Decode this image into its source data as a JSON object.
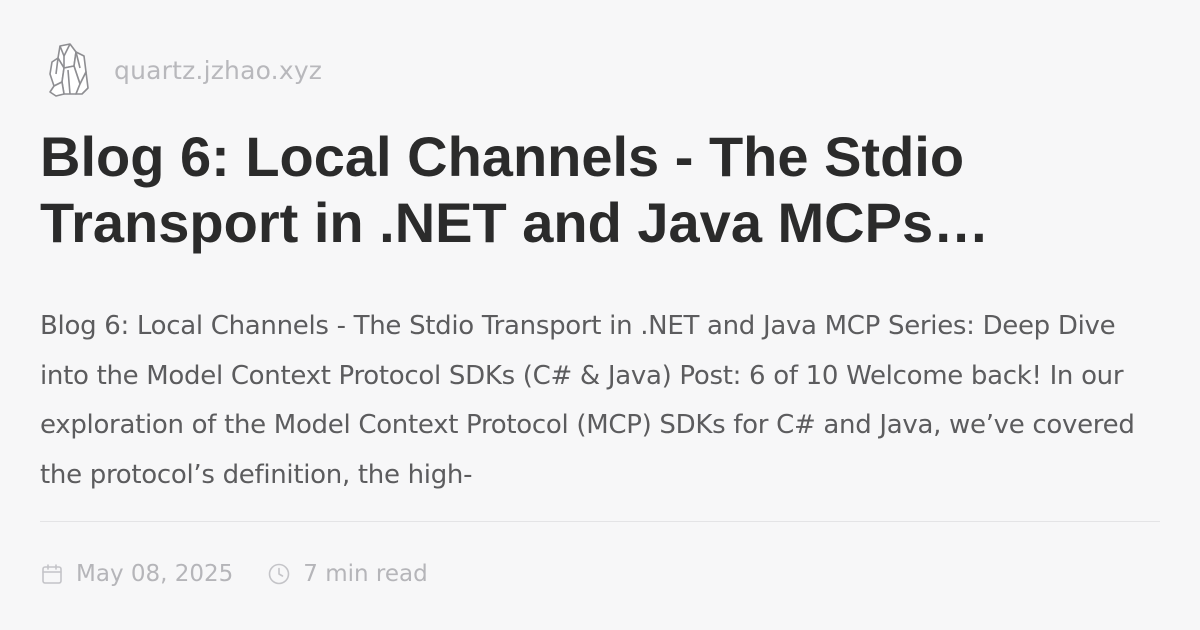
{
  "site": {
    "url": "quartz.jzhao.xyz",
    "logo_icon": "crystal-quartz-icon"
  },
  "post": {
    "title": "Blog 6: Local Channels - The Stdio Transport in .NET and Java MCPs…",
    "description": "Blog 6: Local Channels - The Stdio Transport in .NET and Java MCP Series: Deep Dive into the Model Context Protocol SDKs (C# & Java) Post: 6 of 10 Welcome back! In our exploration of the Model Context Protocol (MCP) SDKs for C# and Java, we’ve covered the protocol’s definition, the high-",
    "date": "May 08, 2025",
    "date_icon": "calendar-icon",
    "read_time": "7 min read",
    "read_time_icon": "clock-icon"
  },
  "colors": {
    "background": "#f7f7f8",
    "title": "#2b2b2b",
    "description": "#5c5c5e",
    "muted": "#b5b5b9",
    "divider": "#e4e4e6"
  }
}
